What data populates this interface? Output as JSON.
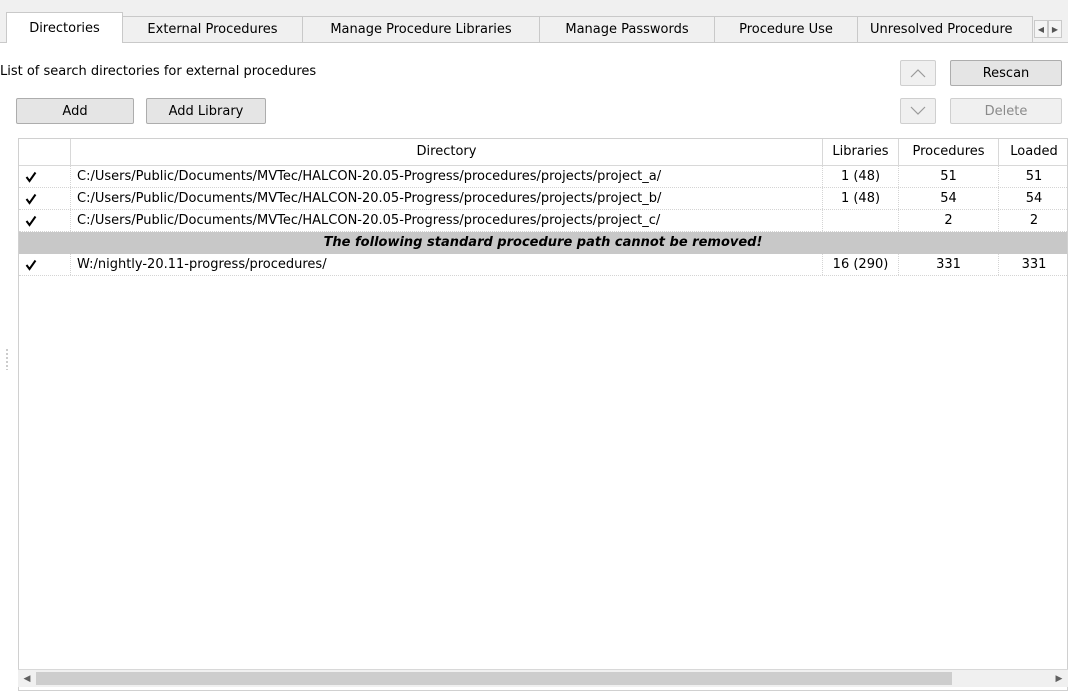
{
  "tabs": [
    {
      "label": "Directories",
      "active": true
    },
    {
      "label": "External Procedures"
    },
    {
      "label": "Manage Procedure Libraries"
    },
    {
      "label": "Manage Passwords"
    },
    {
      "label": "Procedure Use"
    },
    {
      "label": "Unresolved Procedure"
    }
  ],
  "description": "List of search directories for external procedures",
  "buttons": {
    "add": "Add",
    "add_library": "Add Library",
    "rescan": "Rescan",
    "delete": "Delete"
  },
  "table": {
    "headers": [
      "",
      "Directory",
      "Libraries",
      "Procedures",
      "Loaded"
    ],
    "rows": [
      {
        "checked": true,
        "directory": "C:/Users/Public/Documents/MVTec/HALCON-20.05-Progress/procedures/projects/project_a/",
        "libraries": "1 (48)",
        "procedures": "51",
        "loaded": "51"
      },
      {
        "checked": true,
        "directory": "C:/Users/Public/Documents/MVTec/HALCON-20.05-Progress/procedures/projects/project_b/",
        "libraries": "1 (48)",
        "procedures": "54",
        "loaded": "54"
      },
      {
        "checked": true,
        "directory": "C:/Users/Public/Documents/MVTec/HALCON-20.05-Progress/procedures/projects/project_c/",
        "libraries": "",
        "procedures": "2",
        "loaded": "2"
      }
    ],
    "separator": "The following standard procedure path cannot be removed!",
    "standard_rows": [
      {
        "checked": true,
        "directory": "W:/nightly-20.11-progress/procedures/",
        "libraries": "16 (290)",
        "procedures": "331",
        "loaded": "331"
      }
    ]
  },
  "icons": {
    "checkmark": "checkmark-icon",
    "up": "chevron-up-icon",
    "down": "chevron-down-icon",
    "scroll_left": "triangle-left-icon",
    "scroll_right": "triangle-right-icon"
  },
  "colors": {
    "separator_bg": "#c8c8c8",
    "panel_bg": "#ffffff",
    "window_bg": "#f0f0f0"
  }
}
